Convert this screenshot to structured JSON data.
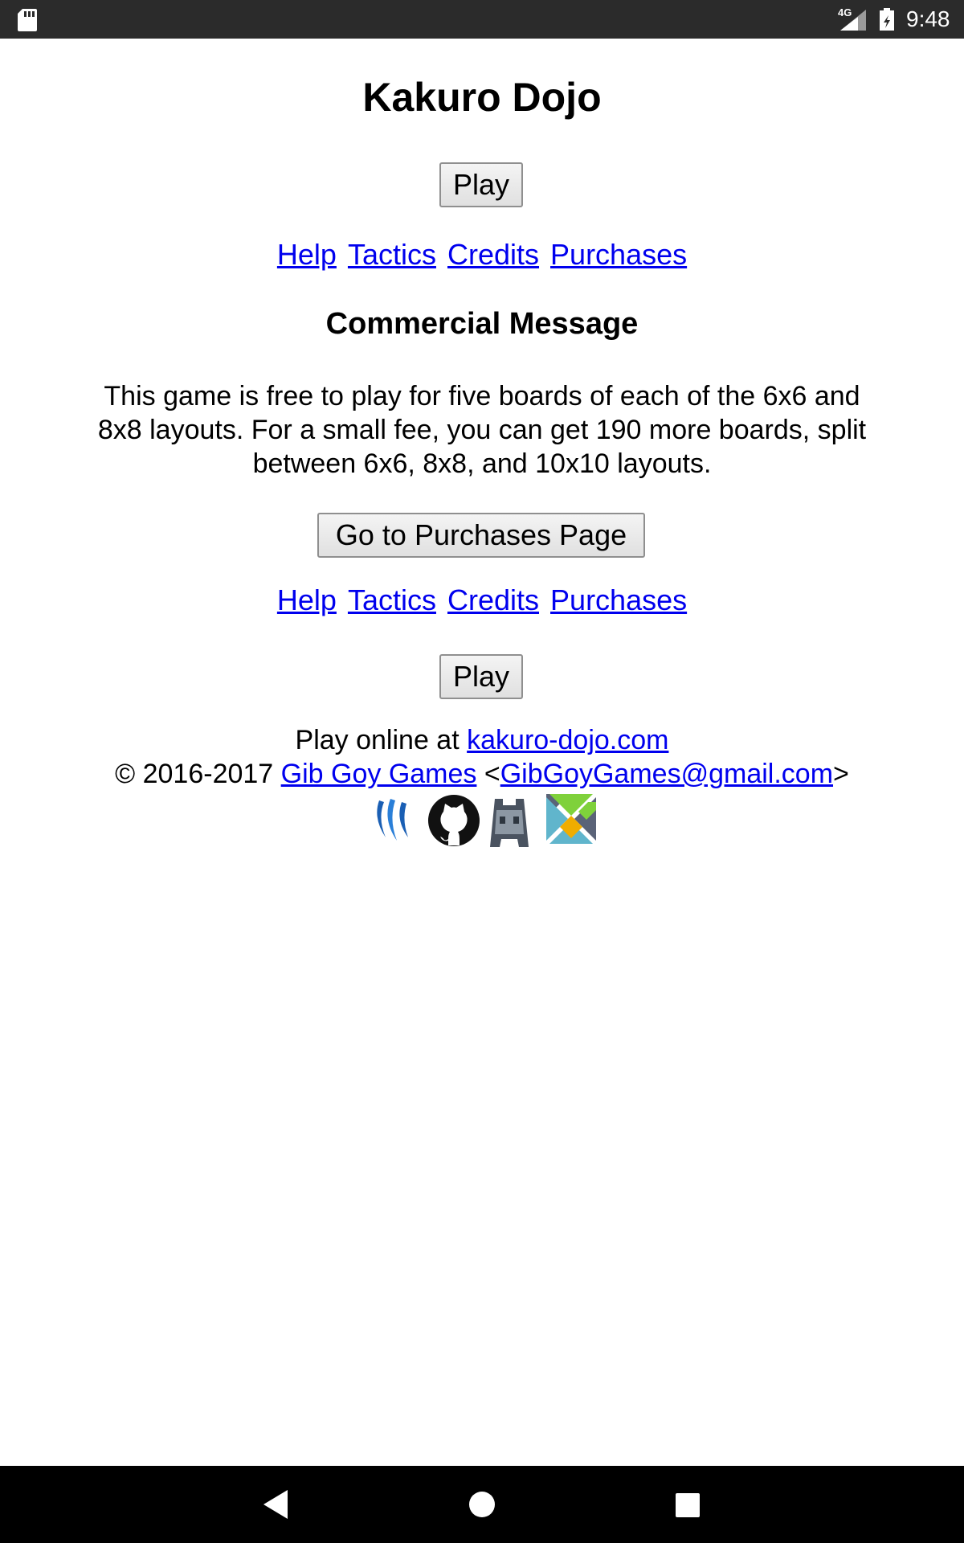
{
  "status_bar": {
    "network": "4G",
    "time": "9:48"
  },
  "page": {
    "title": "Kakuro Dojo",
    "play_button_top": "Play",
    "nav_links": [
      "Help",
      "Tactics",
      "Credits",
      "Purchases"
    ],
    "commercial_heading": "Commercial Message",
    "commercial_text": "This game is free to play for five boards of each of the 6x6 and 8x8 layouts. For a small fee, you can get 190 more boards, split between 6x6, 8x8, and 10x10 layouts.",
    "purchases_button": "Go to Purchases Page",
    "play_button_bottom": "Play"
  },
  "footer": {
    "play_online_prefix": "Play online at ",
    "site_link": "kakuro-dojo.com",
    "copyright": "© 2016-2017 ",
    "company_link": "Gib Goy Games",
    "email_open": " <",
    "email_link": "GibGoyGames@gmail.com",
    "email_close": ">",
    "logos": [
      "steem-icon",
      "github-icon",
      "cordova-icon",
      "elm-icon"
    ]
  },
  "colors": {
    "link": "#0000ee",
    "status_bar": "#2b2b2b",
    "nav_bar": "#000000"
  }
}
